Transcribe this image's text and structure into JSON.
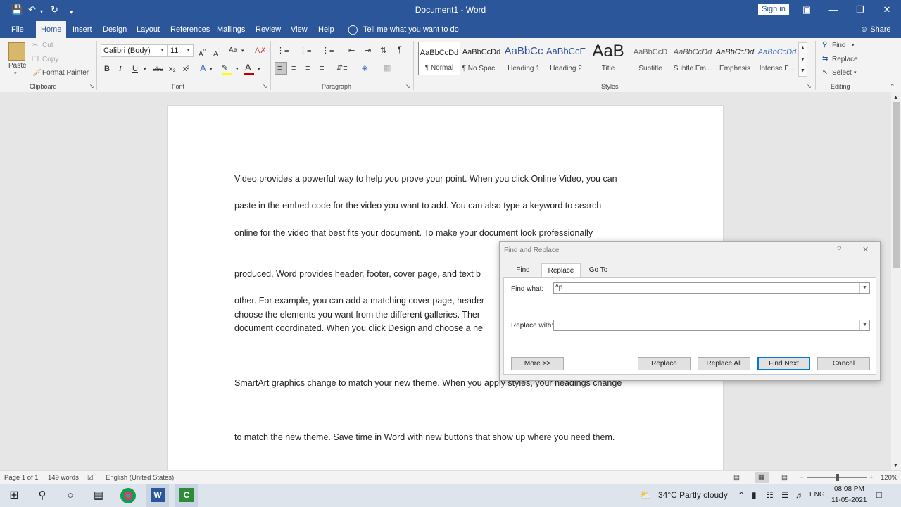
{
  "titlebar": {
    "title": "Document1  -  Word",
    "signin": "Sign in",
    "icons": [
      "save-icon",
      "undo-icon",
      "redo-icon",
      "customize-icon",
      "ribbon-display-icon",
      "minimize-icon",
      "maximize-icon",
      "close-icon"
    ]
  },
  "tabs": [
    "File",
    "Home",
    "Insert",
    "Design",
    "Layout",
    "References",
    "Mailings",
    "Review",
    "View",
    "Help"
  ],
  "tell_me": "Tell me what you want to do",
  "share": "Share",
  "clipboard": {
    "paste": "Paste",
    "cut": "Cut",
    "copy": "Copy",
    "format_painter": "Format Painter",
    "label": "Clipboard"
  },
  "font": {
    "name": "Calibri (Body)",
    "size": "11",
    "label": "Font",
    "bold": "B",
    "italic": "I",
    "underline": "U",
    "strike": "abc",
    "sub": "x₂",
    "sup": "x²",
    "grow": "A^",
    "shrink": "Aˇ",
    "case": "Aa",
    "color_a": "A",
    "text_effects": "A"
  },
  "paragraph": {
    "label": "Paragraph",
    "pilcrow": "¶"
  },
  "styles": {
    "label": "Styles",
    "items": [
      {
        "preview": "AaBbCcDd",
        "name": "¶ Normal"
      },
      {
        "preview": "AaBbCcDd",
        "name": "¶ No Spac..."
      },
      {
        "preview": "AaBbCc",
        "name": "Heading 1"
      },
      {
        "preview": "AaBbCcE",
        "name": "Heading 2"
      },
      {
        "preview": "AaB",
        "name": "Title"
      },
      {
        "preview": "AaBbCcD",
        "name": "Subtitle"
      },
      {
        "preview": "AaBbCcDd",
        "name": "Subtle Em..."
      },
      {
        "preview": "AaBbCcDd",
        "name": "Emphasis"
      },
      {
        "preview": "AaBbCcDd",
        "name": "Intense E..."
      }
    ]
  },
  "editing": {
    "find": "Find",
    "replace": "Replace",
    "select": "Select",
    "label": "Editing"
  },
  "document": {
    "paragraphs": [
      "Video provides a powerful way to help you prove your point. When you click Online Video, you can",
      "paste in the embed code for the video you want to add. You can also type a keyword to search",
      "online for the video that best fits your document. To make your document look professionally",
      "produced, Word provides header, footer, cover page, and text b",
      "other. For example, you can add a matching cover page, header",
      "choose the elements you want from the different galleries. Ther",
      "document coordinated. When you click Design and choose a ne",
      "SmartArt graphics change to match your new theme. When you apply styles, your headings change",
      "to match the new theme. Save time in Word with new buttons that show up where you need them."
    ]
  },
  "dialog": {
    "title": "Find and Replace",
    "help": "?",
    "close": "✕",
    "tabs": [
      "Find",
      "Replace",
      "Go To"
    ],
    "find_label": "Find what:",
    "find_value": "^p",
    "replace_label": "Replace with:",
    "replace_value": "",
    "more": "More >>",
    "replace_btn": "Replace",
    "replace_all": "Replace All",
    "find_next": "Find Next",
    "cancel": "Cancel"
  },
  "status": {
    "page": "Page 1 of 1",
    "words": "149 words",
    "language": "English (United States)",
    "zoom": "120%",
    "zoom_minus": "−",
    "zoom_plus": "+"
  },
  "taskbar": {
    "weather": "34°C  Partly cloudy",
    "lang": "ENG",
    "time": "08:08 PM",
    "date": "11-05-2021"
  },
  "colors": {
    "word_blue": "#2b579a",
    "accent": "#0078d7",
    "font_red": "#c00000",
    "highlight_yellow": "#ffff00"
  }
}
